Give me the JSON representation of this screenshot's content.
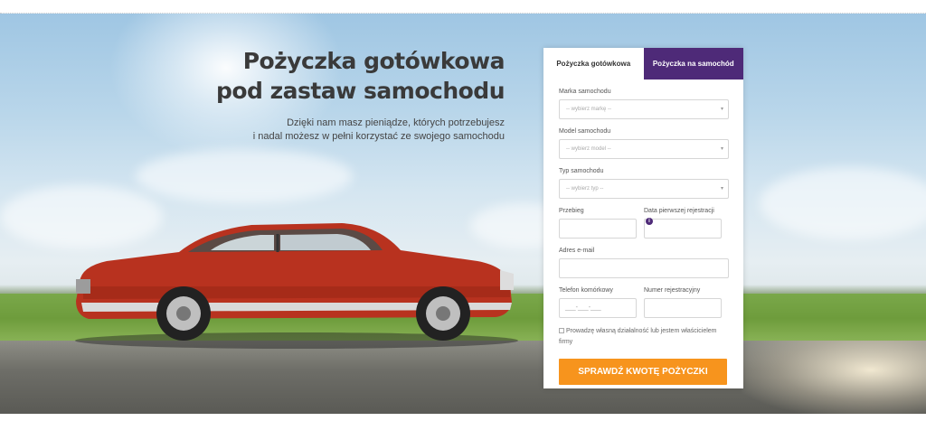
{
  "hero": {
    "title_line1": "Pożyczka gotówkowa",
    "title_line2": "pod zastaw samochodu",
    "subtitle_line1": "Dzięki nam masz pieniądze, których potrzebujesz",
    "subtitle_line2": "i nadal możesz w pełni korzystać ze swojego samochodu"
  },
  "form": {
    "tabs": [
      {
        "label": "Pożyczka gotówkowa",
        "active": true
      },
      {
        "label": "Pożyczka na samochód",
        "active": false
      }
    ],
    "make": {
      "label": "Marka samochodu",
      "placeholder": "-- wybierz markę --"
    },
    "model": {
      "label": "Model samochodu",
      "placeholder": "-- wybierz model --"
    },
    "type": {
      "label": "Typ samochodu",
      "placeholder": "-- wybierz typ --"
    },
    "mileage": {
      "label": "Przebieg",
      "value": ""
    },
    "first_registration": {
      "label": "Data pierwszej rejestracji",
      "value": ""
    },
    "email": {
      "label": "Adres e-mail",
      "value": ""
    },
    "phone": {
      "label": "Telefon komórkowy",
      "placeholder": "___-___-___"
    },
    "registration_number": {
      "label": "Numer rejestracyjny",
      "value": ""
    },
    "business_checkbox": {
      "label_line1": "Prowadzę własną działalność lub jestem właścicielem",
      "label_line2": "firmy",
      "checked": false
    },
    "submit_label": "SPRAWDŹ KWOTĘ POŻYCZKI"
  },
  "colors": {
    "accent_purple": "#4e2a78",
    "cta_orange": "#f7941d",
    "car_red": "#b8321f"
  }
}
